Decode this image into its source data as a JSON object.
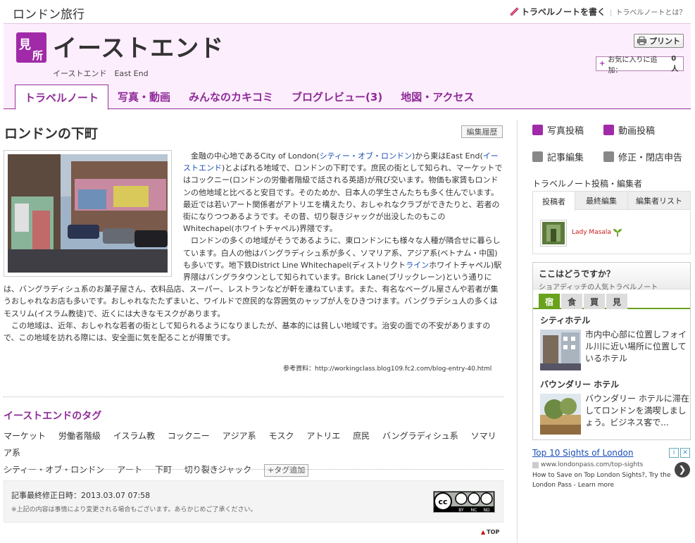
{
  "topbar": {
    "site_title": "ロンドン旅行",
    "write_note": "トラベルノートを書く",
    "what_is": "トラベルノートとは？"
  },
  "header": {
    "badge_char1": "見",
    "badge_char2": "所",
    "title": "イーストエンド",
    "subtitle": "イーストエンド　East End",
    "print_label": "プリント",
    "fav_label": "お気に入りに追加：",
    "fav_count": "0人"
  },
  "tabs": [
    {
      "label": "トラベルノート"
    },
    {
      "label": "写真・動画"
    },
    {
      "label": "みんなのカキコミ"
    },
    {
      "label": "ブログレビュー(3)"
    },
    {
      "label": "地図・アクセス"
    }
  ],
  "main": {
    "heading": "ロンドンの下町",
    "history_label": "編集履歴",
    "p1_a": "金融の中心地であるCity of London(",
    "p1_link1": "シティー・オブ・ロンドン",
    "p1_b": ")から東はEast End(",
    "p1_link2": "イーストエンド",
    "p1_c": ")とよばれる地域で、ロンドンの下町です。庶民の街として知られ、マーケットではコックニー(ロンドンの労働者階級で話される英語)が飛び交います。物価も家賃もロンドンの他地域と比べると安目です。そのためか、日本人の学生さんたちも多く住んでいます。最近では若いアート関係者がアトリエを構えたり、おしゃれなクラブができたりと、若者の街になりつつあるようです。その昔、切り裂きジャックが出没したのもこのWhitechapel(ホワイトチャペル)界隈です。",
    "p2_a": "ロンドンの多くの地域がそうであるように、東ロンドンにも様々な人種が隣合せに暮らしています。白人の他はバングラディシュ系が多く、ソマリア系、アジア系(ベトナム・中国)も多いです。地下鉄District Line Whitechapel(ディストリクト",
    "p2_link": "ライン",
    "p2_b": "ホワイトチャペル)駅界隈はバングラタウンとして知られています。Brick Lane(ブリックレーン)という通りには、バングラディシュ系のお菓子屋さん、衣料品店、スーパー、レストランなどが軒を連ねています。また、有名なベーグル屋さんや若者が集うおしゃれなお店も多いです。おしゃれなたたずまいと、ワイルドで庶民的な雰囲気のャップが人をひきつけます。バングラデシュ人の多くはモスリム(イスラム教徒)で、近くには大きなモスクがあります。",
    "p3": "この地域は、近年、おしゃれな若者の街として知られるようになりましたが、基本的には貧しい地域です。治安の面での不安がありますので、この地域を訪れる際には、安全面に気を配ることが得策です。",
    "source": "参考資料：http://workingclass.blog109.fc2.com/blog-entry-40.html"
  },
  "tags": {
    "heading": "イーストエンドのタグ",
    "items": [
      "マーケット",
      "労働者階級",
      "イスラム教",
      "コックニー",
      "アジア系",
      "モスク",
      "アトリエ",
      "庶民",
      "バングラディシュ系",
      "ソマリア系",
      "シティー・オブ・ロンドン",
      "アート",
      "下町",
      "切り裂きジャック"
    ],
    "add_label": "タグ追加"
  },
  "lastmod": {
    "date_label": "記事最終修正日時：2013.03.07 07:58",
    "note": "※上記の内容は事情により変更される場合もございます。あらかじめご了承ください。",
    "cc_by": "BY",
    "cc_nc": "NC",
    "cc_nd": "ND"
  },
  "top_link": "TOP",
  "sidebar": {
    "photo_post": "写真投稿",
    "video_post": "動画投稿",
    "article_edit": "記事編集",
    "correction": "修正・閉店申告",
    "editors_title": "トラベルノート投稿・編集者",
    "editor_tabs": [
      "投稿者",
      "最終編集",
      "編集者リスト"
    ],
    "editor_name": "Lady Masala",
    "howabout_title": "ここはどうですか？",
    "howabout_sub": "ショアディッチの人気トラベルノート",
    "categories": [
      "宿",
      "食",
      "買",
      "見"
    ],
    "hotels": [
      {
        "name": "シティホテル",
        "desc": "市内中心部に位置しフォイル川に近い場所に位置しているホテル"
      },
      {
        "name": "バウンダリー ホテル",
        "desc": "バウンダリー ホテルに滞在してロンドンを満喫しましょう。ビジネス客で..."
      }
    ]
  },
  "ad": {
    "title": "Top 10 Sights of London",
    "url": "www.londonpass.com/top-sights",
    "desc": "How to Save on Top London Sights?, Try the London Pass - Learn more",
    "next": "❯"
  },
  "colors": {
    "accent_purple": "#8e2a98",
    "header_pink": "#fdeefd",
    "green": "#6aa21d",
    "link_blue": "#1a4fb5"
  }
}
